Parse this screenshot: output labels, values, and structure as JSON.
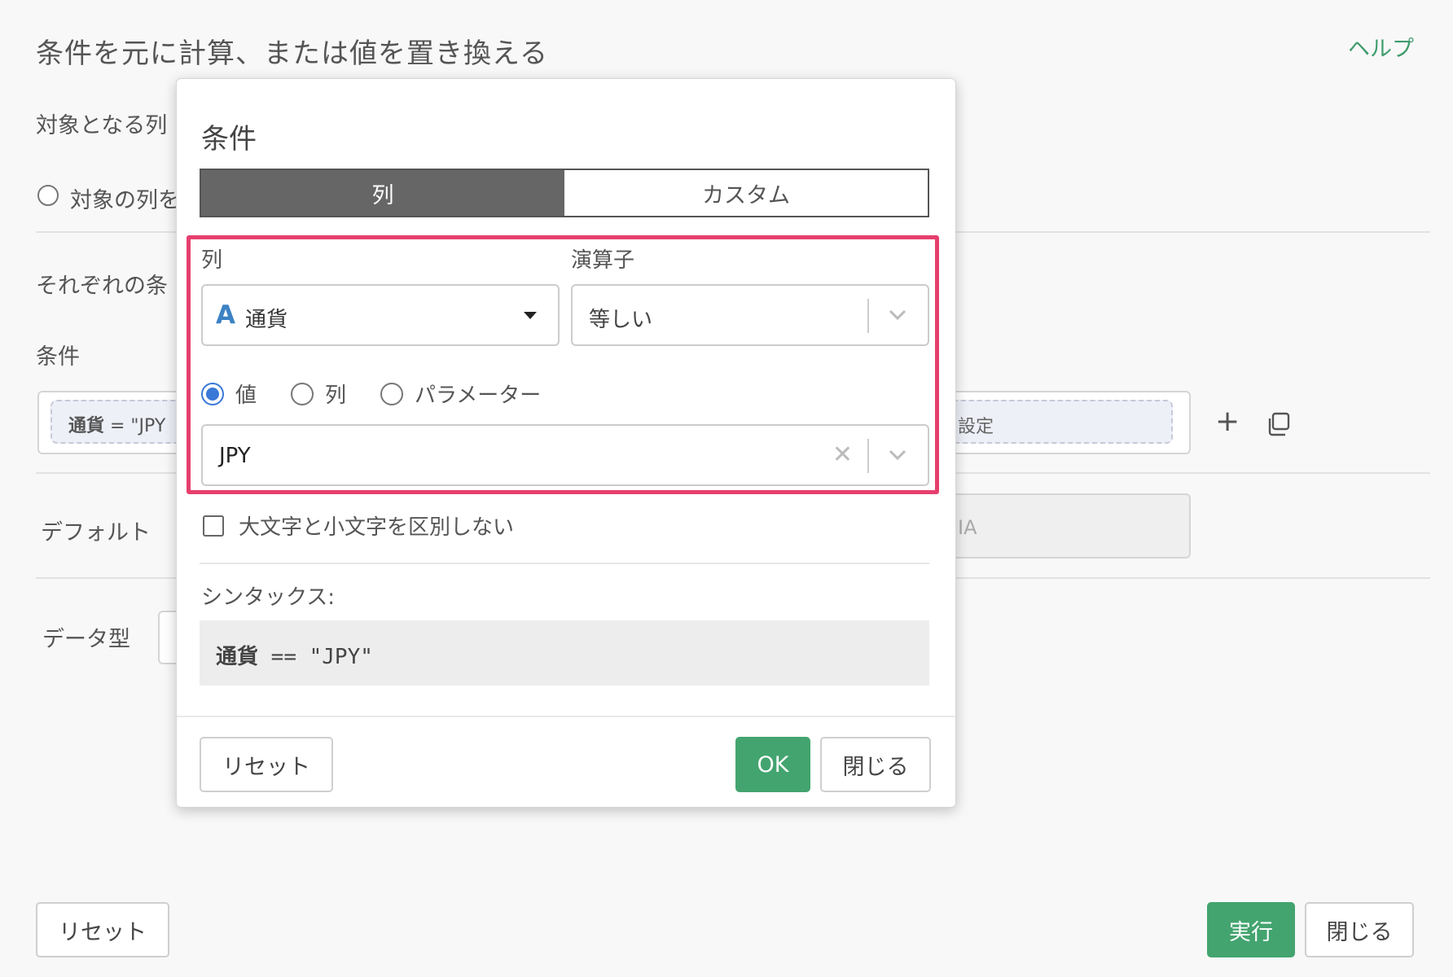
{
  "page": {
    "title": "条件を元に計算、または値を置き換える",
    "help": "ヘルプ",
    "target_label": "対象となる列",
    "target_radio_label": "対象の列を",
    "each_cond_label": "それぞれの条",
    "cond_label": "条件",
    "cond_chip": {
      "column": "通貨",
      "op": " = \"JPY"
    },
    "cond_chip_right": "設定",
    "default_label": "デフォルト",
    "default_value": "IA",
    "datatype_label": "データ型",
    "reset_button": "リセット",
    "run_button": "実行",
    "close_button": "閉じる"
  },
  "modal": {
    "title": "条件",
    "tabs": {
      "column": "列",
      "custom": "カスタム"
    },
    "column_label": "列",
    "operator_label": "演算子",
    "column_type_icon": "A",
    "column_value": "通貨",
    "operator_value": "等しい",
    "radios": {
      "value": "値",
      "column": "列",
      "parameter": "パラメーター"
    },
    "value_input": "JPY",
    "ignore_case_label": "大文字と小文字を区別しない",
    "syntax_label": "シンタックス:",
    "syntax": {
      "column": "通貨",
      "expr": " == \"JPY\""
    },
    "reset_button": "リセット",
    "ok_button": "OK",
    "close_button": "閉じる"
  },
  "colors": {
    "accent_green": "#43a46f",
    "highlight": "#e63f6e",
    "radio_blue": "#3a78d8",
    "type_icon_blue": "#3d82c4"
  }
}
